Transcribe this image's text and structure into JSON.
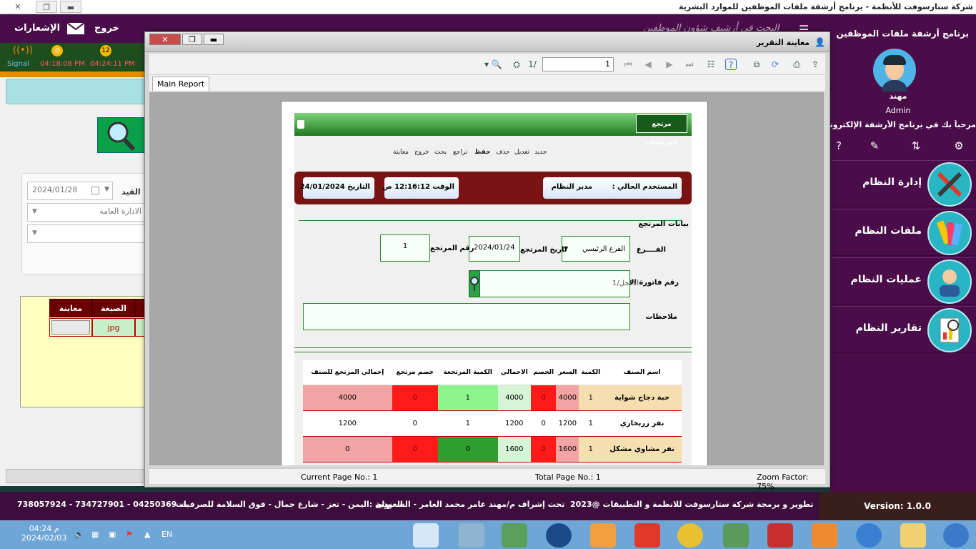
{
  "window": {
    "title": "شركة ستارسوفت للأنظمة - برنامج أرشفة ملفات الموظفين للموارد البشرية",
    "close_label": "✕"
  },
  "top": {
    "exit_label": "خروج",
    "notifications_label": "الإشعارات",
    "faded_title": "البحث في أرشيف شؤون الموظفين"
  },
  "status": {
    "signal_label": "Signal",
    "time1": "04:18:08 PM",
    "time2": "04:24:11 PM",
    "badge_num": "12"
  },
  "left": {
    "date_value": "2024/01/28",
    "date_label": "القيد",
    "dept_value": "الادارة العامة",
    "grid_headers": [
      "معاينة",
      "الصيغة"
    ],
    "grid_ext": "jpg"
  },
  "side": {
    "app_title": "برنامج أرشفة ملفات الموظفين",
    "user_name": "مهند",
    "user_role": "Admin",
    "welcome": "مرحباً بك في برنامج الأرشفة الإلكترونية",
    "menu": [
      {
        "label": "إدارة النظام"
      },
      {
        "label": "ملفات النظام"
      },
      {
        "label": "عمليات النظام"
      },
      {
        "label": "تقارير النظام"
      }
    ]
  },
  "dialog": {
    "title": "معاينة التقرير",
    "page_total_prefix": "1/",
    "page_input": "1",
    "tab_main": "Main Report",
    "status_current": "Current Page No.: 1",
    "status_total": "Total Page No.: 1",
    "status_zoom": "Zoom Factor: 75%"
  },
  "report": {
    "form_title": "مرتجع المرتجعات",
    "toolbar": [
      "جديد",
      "تعديل",
      "حذف",
      "حفظ",
      "تراجع",
      "بحث",
      "خروج",
      "معاينة"
    ],
    "current_user_label": "المستخدم الحالي :",
    "current_user_value": "مدير النظام",
    "time_label": "الوقت",
    "time_value": "12:16:12 ص",
    "date_label": "التاريخ",
    "date_value": "24/01/2024",
    "section_title": "بيانات المرتجع",
    "branch_label": "الفــــرع",
    "branch_value": "الفرع الرئيسي",
    "return_date_label": "تاريخ المرتجع",
    "return_date_value": "2024/01/24",
    "return_no_label": "رقم المرتجع",
    "return_no_value": "1",
    "invoice_label": "رقم فاتورة الابتياع",
    "invoice_value": "1/الاكحل",
    "notes_label": "ملاحظات",
    "table": {
      "headers": [
        "اسم الصنف",
        "الكمية",
        "السعر",
        "الخصم",
        "الاجمالي",
        "الكمية المرتجعة",
        "خصم مرتجع",
        "إجمالي المرتجع للصنف"
      ],
      "rows": [
        [
          "حبة دجاج شواية",
          "1",
          "4000",
          "0",
          "4000",
          "1",
          "0",
          "4000"
        ],
        [
          "نفر زربخاري",
          "1",
          "1200",
          "0",
          "1200",
          "1",
          "0",
          "1200"
        ],
        [
          "نفر مشاوي مشكل",
          "1",
          "1600",
          "0",
          "1600",
          "0",
          "0",
          "0"
        ]
      ]
    }
  },
  "footer": {
    "credits": "تطوير و برمجة شركة ستارسوفت للانظمة و التطبيقات @2023",
    "supervision": "تحت إشراف م/مهند عامر محمد العامر - السعودية",
    "address": "العنوان :اليمن - تعز - شارع جمال - فوق السلامة للصرفيات",
    "phones": "738057924 - 734727901 - 04250369 ت",
    "version": "Version: 1.0.0"
  },
  "taskbar": {
    "time": "04:24 م",
    "date": "2024/02/03",
    "lang": "EN"
  }
}
